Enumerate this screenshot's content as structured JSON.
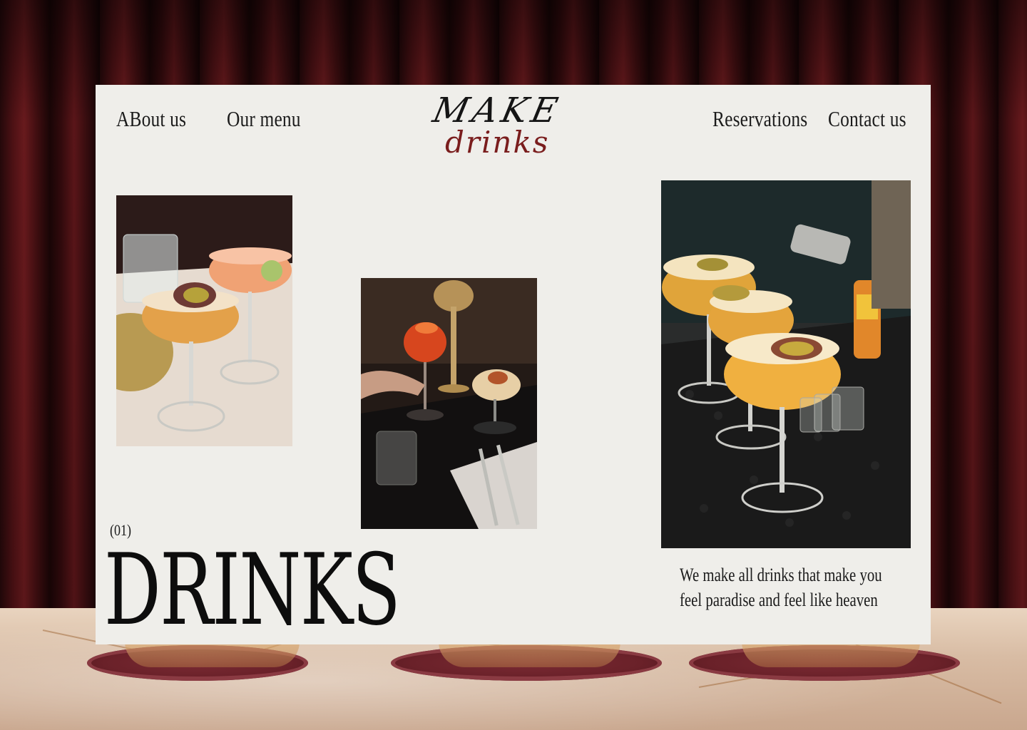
{
  "nav": {
    "about": "ABout us",
    "menu": "Our menu",
    "reservations": "Reservations",
    "contact": "Contact us"
  },
  "logo": {
    "top": "MAKE",
    "bottom": "drinks"
  },
  "hero": {
    "counter": "(01)",
    "title": "DRINKS",
    "tagline": "We make all drinks that make you feel paradise and feel like heaven"
  },
  "colors": {
    "card_bg": "#efeeea",
    "text": "#1b1b1b",
    "accent": "#7a1d1d"
  }
}
